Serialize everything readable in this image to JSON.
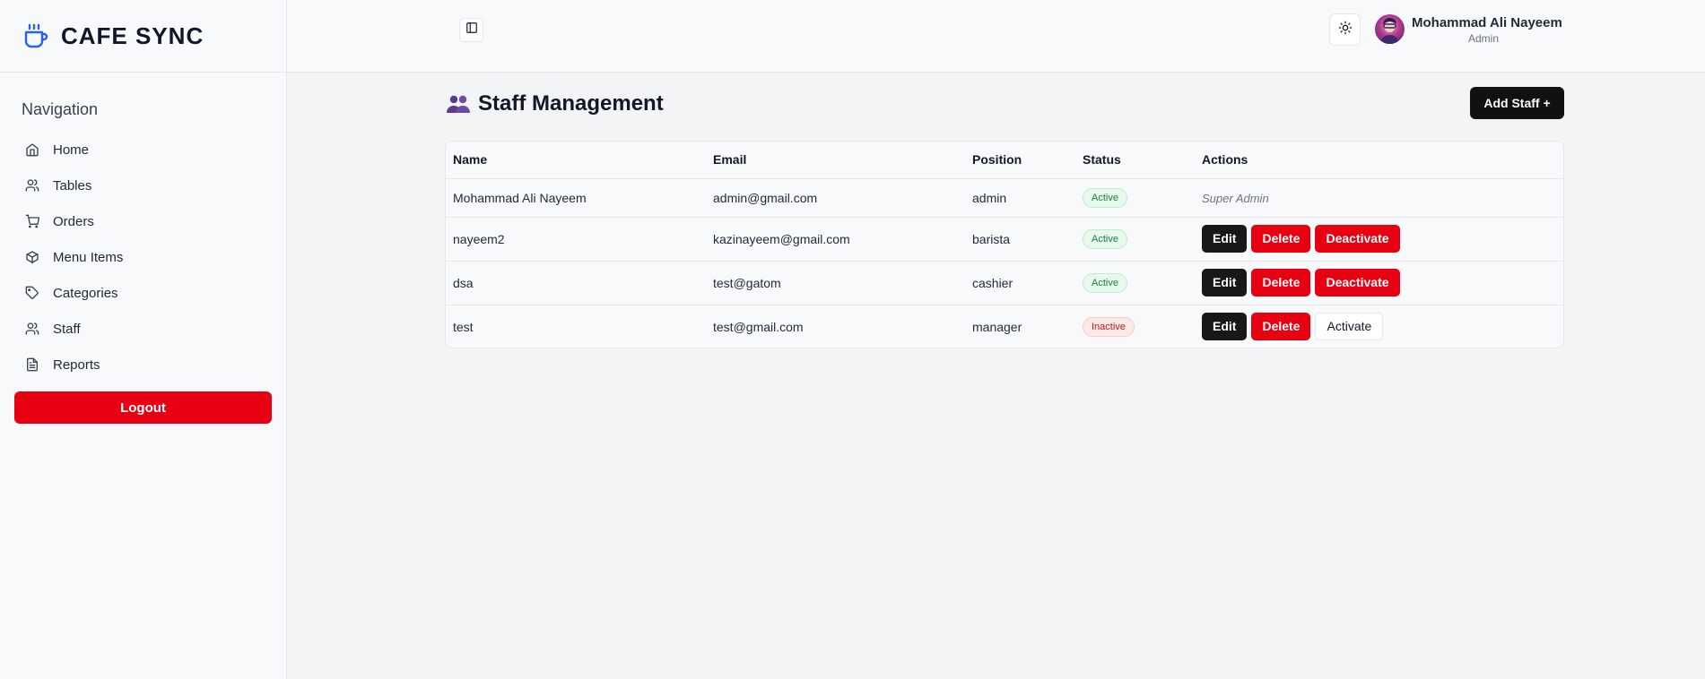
{
  "brand": {
    "name": "CAFE SYNC",
    "icon": "coffee-cup-icon",
    "accent": "#2563eb"
  },
  "sidebar": {
    "title": "Navigation",
    "items": [
      {
        "label": "Home",
        "icon": "home-icon"
      },
      {
        "label": "Tables",
        "icon": "users-icon"
      },
      {
        "label": "Orders",
        "icon": "cart-icon"
      },
      {
        "label": "Menu Items",
        "icon": "box-icon"
      },
      {
        "label": "Categories",
        "icon": "tag-icon"
      },
      {
        "label": "Staff",
        "icon": "users-icon"
      },
      {
        "label": "Reports",
        "icon": "document-icon"
      }
    ],
    "logout_label": "Logout"
  },
  "header": {
    "sidebar_toggle_icon": "sidebar-toggle-icon",
    "theme_icon": "sun-icon",
    "user": {
      "name": "Mohammad Ali Nayeem",
      "role": "Admin"
    }
  },
  "main": {
    "title": "Staff Management",
    "title_icon": "staff-group-icon",
    "add_button": "Add Staff +",
    "table": {
      "columns": [
        "Name",
        "Email",
        "Position",
        "Status",
        "Actions"
      ],
      "rows": [
        {
          "name": "Mohammad Ali Nayeem",
          "email": "admin@gmail.com",
          "position": "admin",
          "status": "Active",
          "note": "Super Admin"
        },
        {
          "name": "nayeem2",
          "email": "kazinayeem@gmail.com",
          "position": "barista",
          "status": "Active",
          "actions": [
            "Edit",
            "Delete",
            "Deactivate"
          ]
        },
        {
          "name": "dsa",
          "email": "test@gatom",
          "position": "cashier",
          "status": "Active",
          "actions": [
            "Edit",
            "Delete",
            "Deactivate"
          ]
        },
        {
          "name": "test",
          "email": "test@gmail.com",
          "position": "manager",
          "status": "Inactive",
          "actions": [
            "Edit",
            "Delete",
            "Activate"
          ]
        }
      ]
    }
  },
  "colors": {
    "danger": "#e60012",
    "dark": "#18181b",
    "active_green": "#15803d",
    "inactive_red": "#b91c1c"
  }
}
